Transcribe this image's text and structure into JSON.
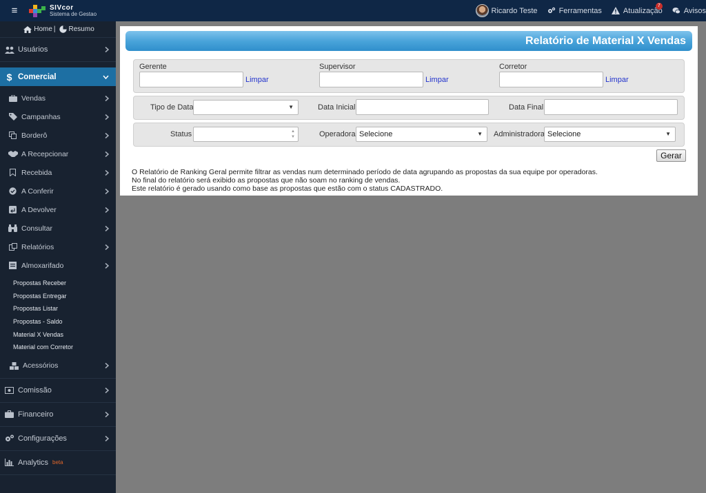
{
  "topbar": {
    "logo_name": "SIVcor",
    "logo_sub": "Sistema de Gestao",
    "user_name": "Ricardo Teste",
    "tools_label": "Ferramentas",
    "updates_label": "Atualização",
    "updates_count": "7",
    "notices_label": "Avisos"
  },
  "sidebar": {
    "home_label": "Home",
    "summary_label": "Resumo",
    "usuarios": "Usuários",
    "comercial": "Comercial",
    "sub": {
      "vendas": "Vendas",
      "campanhas": "Campanhas",
      "bordero": "Borderô",
      "recepcionar": "A Recepcionar",
      "recebida": "Recebida",
      "conferir": "A Conferir",
      "devolver": "A Devolver",
      "consultar": "Consultar",
      "relatorios": "Relatórios",
      "almoxarifado": "Almoxarifado",
      "acessorios": "Acessórios"
    },
    "almox_items": {
      "a": "Propostas Receber",
      "b": "Propostas Entregar",
      "c": "Propostas Listar",
      "d": "Propostas - Saldo",
      "e": "Material X Vendas",
      "f": "Material com Corretor"
    },
    "comissao": "Comissão",
    "financeiro": "Financeiro",
    "configuracoes": "Configurações",
    "analytics": "Analytics",
    "beta": "beta"
  },
  "report": {
    "title": "Relatório de Material X Vendas",
    "gerente_label": "Gerente",
    "supervisor_label": "Supervisor",
    "corretor_label": "Corretor",
    "limpar": "Limpar",
    "tipo_data_label": "Tipo de Data",
    "data_inicial_label": "Data Inicial",
    "data_final_label": "Data Final",
    "status_label": "Status",
    "operadora_label": "Operadora",
    "administradora_label": "Administradora",
    "selecione": "Selecione",
    "gerar": "Gerar",
    "desc_1": "O Relatório de Ranking Geral permite filtrar as vendas num determinado período de data agrupando as propostas da sua equipe por operadoras.",
    "desc_2": "No final do relatório será exibido as propostas que não soam no ranking de vendas.",
    "desc_3": "Este relatório é gerado usando como base as propostas que estão com o status CADASTRADO."
  }
}
